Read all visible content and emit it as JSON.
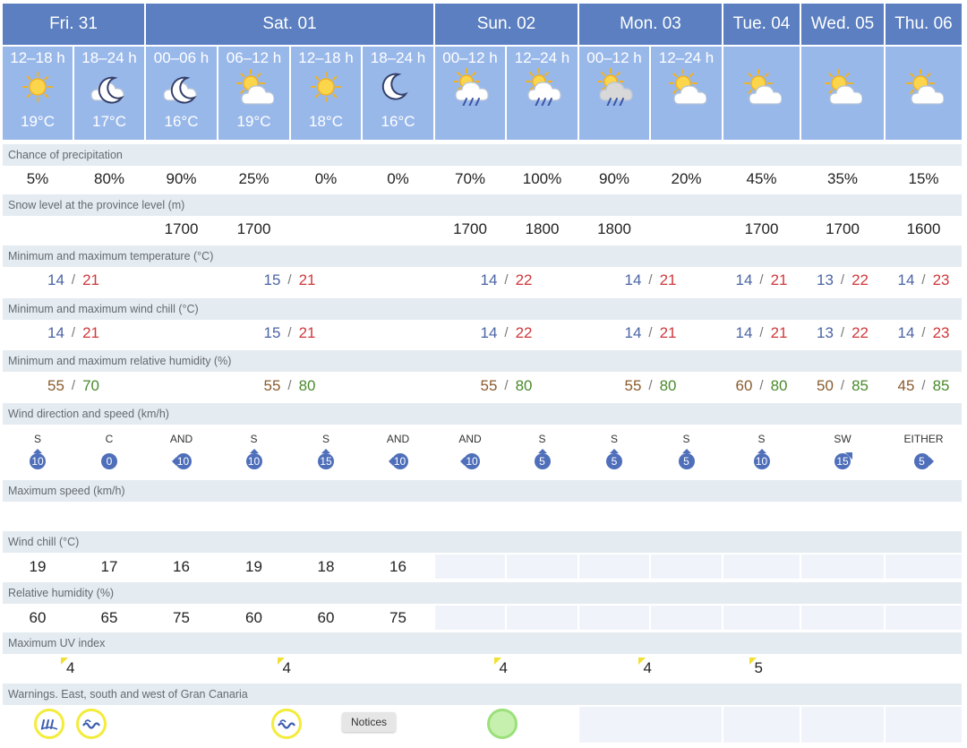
{
  "days": [
    {
      "key": "fri",
      "label": "Fri. 31"
    },
    {
      "key": "sat",
      "label": "Sat. 01"
    },
    {
      "key": "sun",
      "label": "Sun. 02"
    },
    {
      "key": "mon",
      "label": "Mon. 03"
    },
    {
      "key": "tue",
      "label": "Tue. 04"
    },
    {
      "key": "wed",
      "label": "Wed. 05"
    },
    {
      "key": "thu",
      "label": "Thu. 06"
    }
  ],
  "periods": [
    {
      "label": "12–18 h",
      "icon": "sun-icon",
      "temp": "19°C"
    },
    {
      "label": "18–24 h",
      "icon": "night-cloud-icon",
      "temp": "17°C"
    },
    {
      "label": "00–06 h",
      "icon": "night-cloud-icon",
      "temp": "16°C"
    },
    {
      "label": "06–12 h",
      "icon": "sun-cloud-icon",
      "temp": "19°C"
    },
    {
      "label": "12–18 h",
      "icon": "sun-icon",
      "temp": "18°C"
    },
    {
      "label": "18–24 h",
      "icon": "moon-icon",
      "temp": "16°C"
    },
    {
      "label": "00–12 h",
      "icon": "sun-rain-icon",
      "temp": ""
    },
    {
      "label": "12–24 h",
      "icon": "sun-rain-icon",
      "temp": ""
    },
    {
      "label": "00–12 h",
      "icon": "sun-rain-grey-icon",
      "temp": ""
    },
    {
      "label": "12–24 h",
      "icon": "sun-cloud-icon",
      "temp": ""
    },
    {
      "label": "",
      "icon": "sun-cloud-icon",
      "temp": ""
    },
    {
      "label": "",
      "icon": "sun-cloud-icon",
      "temp": ""
    },
    {
      "label": "",
      "icon": "sun-cloud-icon",
      "temp": ""
    }
  ],
  "sections": {
    "precip": "Chance of precipitation",
    "snow": "Snow level at the province level (m)",
    "temp": "Minimum and maximum temperature (°C)",
    "chill": "Minimum and maximum wind chill (°C)",
    "humidity": "Minimum and maximum relative humidity (%)",
    "wind": "Wind direction and speed (km/h)",
    "maxspeed": "Maximum speed (km/h)",
    "windchill": "Wind chill (°C)",
    "relhum": "Relative humidity (%)",
    "uv": "Maximum UV index",
    "warnings": "Warnings. East, south and west of Gran Canaria"
  },
  "precip": [
    "5%",
    "80%",
    "90%",
    "25%",
    "0%",
    "0%",
    "70%",
    "100%",
    "90%",
    "20%",
    "45%",
    "35%",
    "15%"
  ],
  "snow": [
    "",
    "",
    "1700",
    "1700",
    "",
    "",
    "1700",
    "1800",
    "1800",
    "",
    "1700",
    "1700",
    "1600"
  ],
  "temp_minmax": [
    {
      "min": "14",
      "max": "21"
    },
    {
      "min": "15",
      "max": "21"
    },
    {
      "min": "14",
      "max": "22"
    },
    {
      "min": "14",
      "max": "21"
    },
    {
      "min": "14",
      "max": "21"
    },
    {
      "min": "13",
      "max": "22"
    },
    {
      "min": "14",
      "max": "23"
    }
  ],
  "chill_minmax": [
    {
      "min": "14",
      "max": "21"
    },
    {
      "min": "15",
      "max": "21"
    },
    {
      "min": "14",
      "max": "22"
    },
    {
      "min": "14",
      "max": "21"
    },
    {
      "min": "14",
      "max": "21"
    },
    {
      "min": "13",
      "max": "22"
    },
    {
      "min": "14",
      "max": "23"
    }
  ],
  "hum_minmax": [
    {
      "min": "55",
      "max": "70"
    },
    {
      "min": "55",
      "max": "80"
    },
    {
      "min": "55",
      "max": "80"
    },
    {
      "min": "55",
      "max": "80"
    },
    {
      "min": "60",
      "max": "80"
    },
    {
      "min": "50",
      "max": "85"
    },
    {
      "min": "45",
      "max": "85"
    }
  ],
  "wind": [
    {
      "dir": "S",
      "speed": "10",
      "arrow": "up"
    },
    {
      "dir": "C",
      "speed": "0",
      "arrow": "none"
    },
    {
      "dir": "AND",
      "speed": "10",
      "arrow": "left"
    },
    {
      "dir": "S",
      "speed": "10",
      "arrow": "up"
    },
    {
      "dir": "S",
      "speed": "15",
      "arrow": "up"
    },
    {
      "dir": "AND",
      "speed": "10",
      "arrow": "left"
    },
    {
      "dir": "AND",
      "speed": "10",
      "arrow": "left"
    },
    {
      "dir": "S",
      "speed": "5",
      "arrow": "up"
    },
    {
      "dir": "S",
      "speed": "5",
      "arrow": "up"
    },
    {
      "dir": "S",
      "speed": "5",
      "arrow": "up"
    },
    {
      "dir": "S",
      "speed": "10",
      "arrow": "up"
    },
    {
      "dir": "SW",
      "speed": "15",
      "arrow": "upright"
    },
    {
      "dir": "EITHER",
      "speed": "5",
      "arrow": "right"
    }
  ],
  "windchill": [
    "19",
    "17",
    "16",
    "19",
    "18",
    "16"
  ],
  "relhum": [
    "60",
    "65",
    "75",
    "60",
    "60",
    "75"
  ],
  "uv": [
    "4",
    "4",
    "4",
    "4",
    "5",
    "",
    ""
  ],
  "notices_label": "Notices",
  "colors": {
    "header": "#5b7fc0",
    "subheader": "#99b8ea",
    "band": "#e4ebf1",
    "min_temp": "#4a64a4",
    "max_temp": "#d0383b",
    "badge": "#4f6fba",
    "warning_yellow": "#f3ec3b",
    "warning_green": "#9be07a"
  }
}
